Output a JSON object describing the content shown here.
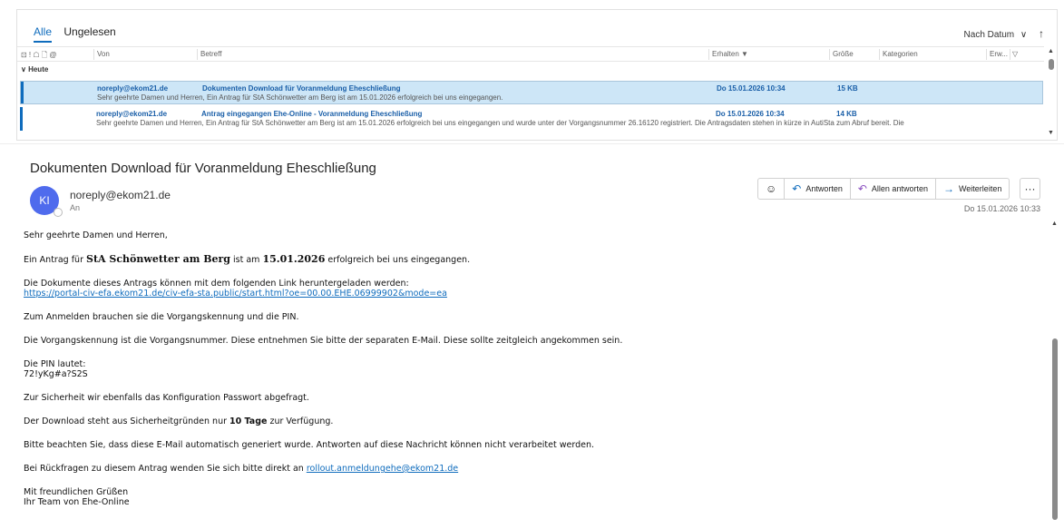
{
  "filters": {
    "all": "Alle",
    "unread": "Ungelesen"
  },
  "sort": {
    "label": "Nach Datum",
    "chevron": "∨",
    "arrow": "↑"
  },
  "columns": {
    "icons": "⊡ ! ☖ 🗋 @",
    "from": "Von",
    "subject": "Betreff",
    "received": "Erhalten ▼",
    "size": "Größe",
    "categories": "Kategorien",
    "ext": "Erw...",
    "filter_icon": "▽"
  },
  "group": {
    "label": "∨  Heute"
  },
  "messages": [
    {
      "from": "noreply@ekom21.de",
      "subject": "Dokumenten Download für  Voranmeldung Eheschließung",
      "received": "Do 15.01.2026 10:34",
      "size": "15 KB",
      "preview": "Sehr geehrte Damen und Herren,  Ein Antrag für StA Schönwetter am Berg ist am 15.01.2026 erfolgreich bei uns eingegangen."
    },
    {
      "from": "noreply@ekom21.de",
      "subject": "Antrag eingegangen Ehe-Online - Voranmeldung Eheschließung",
      "received": "Do 15.01.2026 10:34",
      "size": "14 KB",
      "preview": "Sehr geehrte Damen und Herren,  Ein Antrag für StA Schönwetter am Berg ist am 15.01.2026 erfolgreich bei uns eingegangen und wurde unter der Vorgangsnummer 26.16120 registriert.  Die Antragsdaten stehen in kürze in AutiSta zum Abruf bereit. Die"
    }
  ],
  "reading": {
    "subject": "Dokumenten Download für  Voranmeldung Eheschließung",
    "avatar_initials": "KI",
    "sender": "noreply@ekom21.de",
    "to_label": "An",
    "date": "Do 15.01.2026 10:33",
    "actions": {
      "emoji_icon": "☺",
      "reply": "Antworten",
      "reply_all": "Allen antworten",
      "forward": "Weiterleiten",
      "more": "···"
    },
    "body": {
      "greeting": "Sehr geehrte Damen und Herren,",
      "p1_a": "Ein Antrag für ",
      "p1_office": "StA Schönwetter am Berg",
      "p1_b": " ist am ",
      "p1_date": "15.01.2026",
      "p1_c": " erfolgreich bei uns eingegangen.",
      "p2": "Die Dokumente dieses Antrags können mit dem folgenden Link heruntergeladen werden:",
      "link": "https://portal-civ-efa.ekom21.de/civ-efa-sta.public/start.html?oe=00.00.EHE.06999902&mode=ea",
      "p3": "Zum Anmelden brauchen sie die Vorgangskennung und die PIN.",
      "p4": "Die Vorgangskennung ist die Vorgangsnummer. Diese entnehmen Sie bitte der separaten E-Mail. Diese sollte zeitgleich angekommen sein.",
      "pin_label": "Die PIN lautet:",
      "pin": "72!yKg#a?S2S",
      "p5": "Zur Sicherheit wir ebenfalls das Konfiguration Passwort abgefragt.",
      "p6_a": "Der Download steht aus Sicherheitgründen nur ",
      "p6_days": "10 Tage",
      "p6_b": " zur Verfügung.",
      "p7": "Bitte beachten Sie, dass diese E-Mail automatisch generiert wurde. Antworten auf diese Nachricht können nicht verarbeitet werden.",
      "p8_a": "Bei Rückfragen zu diesem Antrag wenden Sie sich bitte direkt an ",
      "p8_mail": "rollout.anmeldungehe@ekom21.de",
      "closing1": "Mit freundlichen Grüßen",
      "closing2": "Ihr Team von Ehe-Online"
    }
  }
}
